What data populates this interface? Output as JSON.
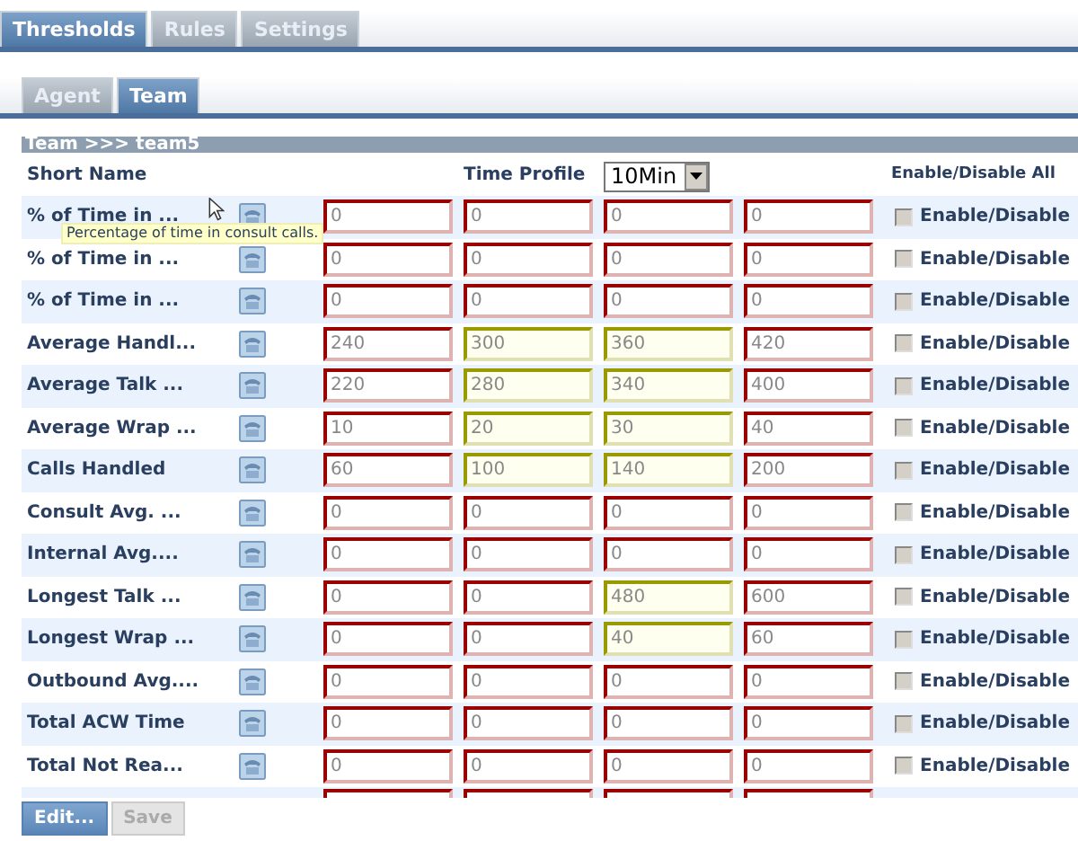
{
  "main_tabs": [
    {
      "label": "Thresholds",
      "selected": true
    },
    {
      "label": "Rules",
      "selected": false
    },
    {
      "label": "Settings",
      "selected": false
    }
  ],
  "sub_tabs": [
    {
      "label": "Agent",
      "selected": false
    },
    {
      "label": "Team",
      "selected": true
    }
  ],
  "breadcrumb": "Team >>> team5",
  "header": {
    "short_name": "Short Name",
    "time_profile": "Time Profile",
    "time_profile_value": "10Min",
    "enable_all": "Enable/Disable All"
  },
  "rows": [
    {
      "short_name": "% of Time in ...",
      "tooltip": "Percentage of time in consult calls.",
      "enabled": false,
      "enable_label": "Enable/Disable",
      "fields": [
        {
          "value": "0",
          "color": "#990000"
        },
        {
          "value": "0",
          "color": "#990000"
        },
        {
          "value": "0",
          "color": "#990000"
        },
        {
          "value": "0",
          "color": "#990000"
        }
      ]
    },
    {
      "short_name": "% of Time in ...",
      "enabled": false,
      "enable_label": "Enable/Disable",
      "fields": [
        {
          "value": "0",
          "color": "#990000"
        },
        {
          "value": "0",
          "color": "#990000"
        },
        {
          "value": "0",
          "color": "#990000"
        },
        {
          "value": "0",
          "color": "#990000"
        }
      ]
    },
    {
      "short_name": "% of Time in ...",
      "enabled": false,
      "enable_label": "Enable/Disable",
      "fields": [
        {
          "value": "0",
          "color": "#990000"
        },
        {
          "value": "0",
          "color": "#990000"
        },
        {
          "value": "0",
          "color": "#990000"
        },
        {
          "value": "0",
          "color": "#990000"
        }
      ]
    },
    {
      "short_name": "Average Handl...",
      "enabled": false,
      "enable_label": "Enable/Disable",
      "fields": [
        {
          "value": "240",
          "color": "#990000"
        },
        {
          "value": "300",
          "color": "#999900"
        },
        {
          "value": "360",
          "color": "#999900"
        },
        {
          "value": "420",
          "color": "#990000"
        }
      ]
    },
    {
      "short_name": "Average Talk ...",
      "enabled": false,
      "enable_label": "Enable/Disable",
      "fields": [
        {
          "value": "220",
          "color": "#990000"
        },
        {
          "value": "280",
          "color": "#999900"
        },
        {
          "value": "340",
          "color": "#999900"
        },
        {
          "value": "400",
          "color": "#990000"
        }
      ]
    },
    {
      "short_name": "Average Wrap ...",
      "enabled": false,
      "enable_label": "Enable/Disable",
      "fields": [
        {
          "value": "10",
          "color": "#990000"
        },
        {
          "value": "20",
          "color": "#999900"
        },
        {
          "value": "30",
          "color": "#999900"
        },
        {
          "value": "40",
          "color": "#990000"
        }
      ]
    },
    {
      "short_name": "Calls Handled",
      "enabled": false,
      "enable_label": "Enable/Disable",
      "fields": [
        {
          "value": "60",
          "color": "#990000"
        },
        {
          "value": "100",
          "color": "#999900"
        },
        {
          "value": "140",
          "color": "#999900"
        },
        {
          "value": "200",
          "color": "#990000"
        }
      ]
    },
    {
      "short_name": "Consult Avg. ...",
      "enabled": false,
      "enable_label": "Enable/Disable",
      "fields": [
        {
          "value": "0",
          "color": "#990000"
        },
        {
          "value": "0",
          "color": "#990000"
        },
        {
          "value": "0",
          "color": "#990000"
        },
        {
          "value": "0",
          "color": "#990000"
        }
      ]
    },
    {
      "short_name": "Internal Avg....",
      "enabled": false,
      "enable_label": "Enable/Disable",
      "fields": [
        {
          "value": "0",
          "color": "#990000"
        },
        {
          "value": "0",
          "color": "#990000"
        },
        {
          "value": "0",
          "color": "#990000"
        },
        {
          "value": "0",
          "color": "#990000"
        }
      ]
    },
    {
      "short_name": "Longest Talk ...",
      "enabled": false,
      "enable_label": "Enable/Disable",
      "fields": [
        {
          "value": "0",
          "color": "#990000"
        },
        {
          "value": "0",
          "color": "#990000"
        },
        {
          "value": "480",
          "color": "#999900"
        },
        {
          "value": "600",
          "color": "#990000"
        }
      ]
    },
    {
      "short_name": "Longest Wrap ...",
      "enabled": false,
      "enable_label": "Enable/Disable",
      "fields": [
        {
          "value": "0",
          "color": "#990000"
        },
        {
          "value": "0",
          "color": "#990000"
        },
        {
          "value": "40",
          "color": "#999900"
        },
        {
          "value": "60",
          "color": "#990000"
        }
      ]
    },
    {
      "short_name": "Outbound Avg....",
      "enabled": false,
      "enable_label": "Enable/Disable",
      "fields": [
        {
          "value": "0",
          "color": "#990000"
        },
        {
          "value": "0",
          "color": "#990000"
        },
        {
          "value": "0",
          "color": "#990000"
        },
        {
          "value": "0",
          "color": "#990000"
        }
      ]
    },
    {
      "short_name": "Total ACW Time",
      "enabled": false,
      "enable_label": "Enable/Disable",
      "fields": [
        {
          "value": "0",
          "color": "#990000"
        },
        {
          "value": "0",
          "color": "#990000"
        },
        {
          "value": "0",
          "color": "#990000"
        },
        {
          "value": "0",
          "color": "#990000"
        }
      ]
    },
    {
      "short_name": "Total Not Rea...",
      "enabled": false,
      "enable_label": "Enable/Disable",
      "fields": [
        {
          "value": "0",
          "color": "#990000"
        },
        {
          "value": "0",
          "color": "#990000"
        },
        {
          "value": "0",
          "color": "#990000"
        },
        {
          "value": "0",
          "color": "#990000"
        }
      ]
    }
  ],
  "clipped_row": {
    "fields": [
      {
        "color": "#990000"
      },
      {
        "color": "#990000"
      },
      {
        "color": "#990000"
      },
      {
        "color": "#990000"
      }
    ]
  },
  "buttons": [
    {
      "label": "Edit...",
      "disabled": false
    },
    {
      "label": "Save",
      "disabled": true
    }
  ]
}
